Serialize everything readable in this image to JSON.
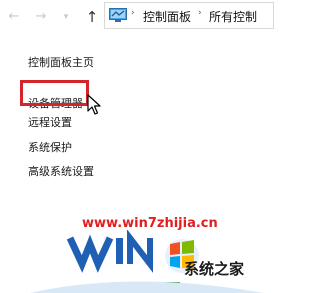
{
  "nav": {
    "back_glyph": "←",
    "forward_glyph": "→",
    "recent_glyph": "▾",
    "up_glyph": "↑",
    "chevron": "›"
  },
  "address": {
    "crumbs": [
      "控制面板",
      "所有控制"
    ]
  },
  "sidebar": {
    "items": [
      {
        "label": "控制面板主页"
      },
      {
        "label": "设备管理器"
      },
      {
        "label": "远程设置"
      },
      {
        "label": "系统保护"
      },
      {
        "label": "高级系统设置"
      }
    ]
  },
  "highlight_color": "#d4252b",
  "watermark": {
    "url": "www.win7zhijia.cn",
    "site_name": "系统之家"
  }
}
